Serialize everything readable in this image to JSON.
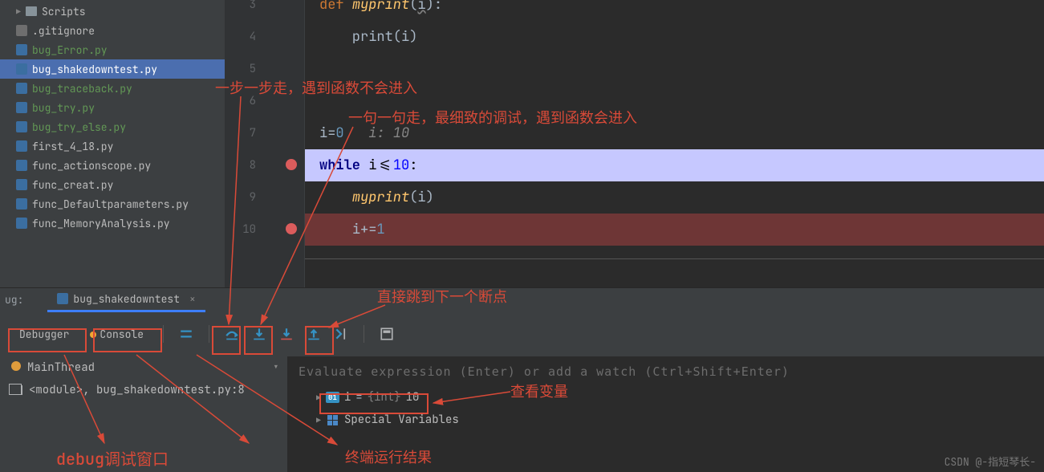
{
  "project_tree": {
    "folder": "Scripts",
    "items": [
      {
        "name": ".gitignore",
        "type": "gitignore"
      },
      {
        "name": "bug_Error.py",
        "type": "py",
        "vcs": true
      },
      {
        "name": "bug_shakedowntest.py",
        "type": "py",
        "vcs": true,
        "selected": true
      },
      {
        "name": "bug_traceback.py",
        "type": "py",
        "vcs": true
      },
      {
        "name": "bug_try.py",
        "type": "py",
        "vcs": true
      },
      {
        "name": "bug_try_else.py",
        "type": "py",
        "vcs": true
      },
      {
        "name": "first_4_18.py",
        "type": "py"
      },
      {
        "name": "func_actionscope.py",
        "type": "py"
      },
      {
        "name": "func_creat.py",
        "type": "py"
      },
      {
        "name": "func_Defaultparameters.py",
        "type": "py"
      },
      {
        "name": "func_MemoryAnalysis.py",
        "type": "py"
      }
    ]
  },
  "editor": {
    "lines": [
      3,
      4,
      5,
      6,
      7,
      8,
      9,
      10
    ],
    "line3_def": "def ",
    "line3_fn": "myprint",
    "line3_param": "i",
    "line3_end": ":",
    "line4_text": "    print(i)",
    "line7_pre": "i=",
    "line7_val": "0",
    "line7_inlay": "   i: 10",
    "line8_kw": "while ",
    "line8_expr": "i<=",
    "line8_num": "10",
    "line8_colon": ":",
    "line9_fn": "myprint",
    "line9_arg": "(i)",
    "line10_var": "i+=",
    "line10_num": "1"
  },
  "debug": {
    "tab_label": "ug:",
    "run_config": "bug_shakedowntest",
    "tabs": {
      "debugger": "Debugger",
      "console": "Console"
    },
    "thread": "MainThread",
    "frame": "<module>, bug_shakedowntest.py:8",
    "eval_hint": "Evaluate expression (Enter) or add a watch (Ctrl+Shift+Enter)",
    "var_badge": "01",
    "var_name": "i",
    "var_type": "{int}",
    "var_value": "10",
    "special_vars": "Special Variables"
  },
  "annotations": {
    "a1": "一步一步走，遇到函数不会进入",
    "a2": "一句一句走，最细致的调试，遇到函数会进入",
    "a3": "直接跳到下一个断点",
    "a4": "查看变量",
    "a5": "debug调试窗口",
    "a6": "终端运行结果"
  },
  "watermark": "CSDN @-指短琴长-"
}
